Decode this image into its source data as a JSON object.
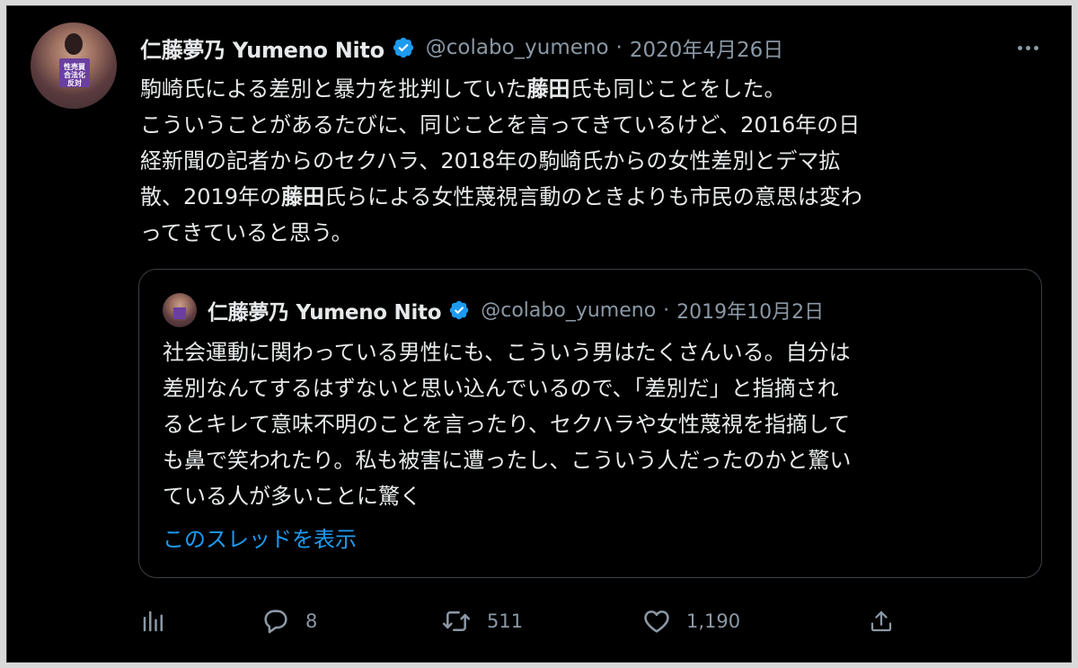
{
  "tweet": {
    "display_name": "仁藤夢乃 Yumeno Nito",
    "handle": "@colabo_yumeno",
    "separator": "·",
    "date": "2020年4月26日",
    "avatar_sign_text": "性売買\n合法化\n反対",
    "text_lines": [
      {
        "before": "駒崎氏による差別と暴力を批判していた",
        "bold": "藤田",
        "after": "氏も同じことをした。"
      },
      {
        "before": "こういうことがあるたびに、同じことを言ってきているけど、2016年の日",
        "bold": "",
        "after": ""
      },
      {
        "before": "経新聞の記者からのセクハラ、2018年の駒崎氏からの女性差別とデマ拡",
        "bold": "",
        "after": ""
      },
      {
        "before": "散、2019年の",
        "bold": "藤田",
        "after": "氏らによる女性蔑視言動のときよりも市民の意思は変わ"
      },
      {
        "before": "ってきていると思う。",
        "bold": "",
        "after": ""
      }
    ]
  },
  "quote": {
    "display_name": "仁藤夢乃 Yumeno Nito",
    "handle": "@colabo_yumeno",
    "separator": "·",
    "date": "2019年10月2日",
    "text_lines": [
      "社会運動に関わっている男性にも、こういう男はたくさんいる。自分は",
      "差別なんてするはずないと思い込んでいるので、「差別だ」と指摘され",
      "るとキレて意味不明のことを言ったり、セクハラや女性蔑視を指摘して",
      "も鼻で笑われたり。私も被害に遭ったし、こういう人だったのかと驚い",
      "ている人が多いことに驚く"
    ],
    "show_thread_label": "このスレッドを表示"
  },
  "actions": {
    "analytics": {
      "icon": "analytics-icon"
    },
    "reply": {
      "icon": "reply-icon",
      "count": "8"
    },
    "retweet": {
      "icon": "retweet-icon",
      "count": "511"
    },
    "like": {
      "icon": "like-icon",
      "count": "1,190"
    },
    "share": {
      "icon": "share-icon"
    }
  },
  "colors": {
    "background": "#000000",
    "text": "#e7e9ea",
    "secondary": "#8b98a5",
    "link": "#1d9bf0",
    "verified": "#1d9bf0"
  }
}
